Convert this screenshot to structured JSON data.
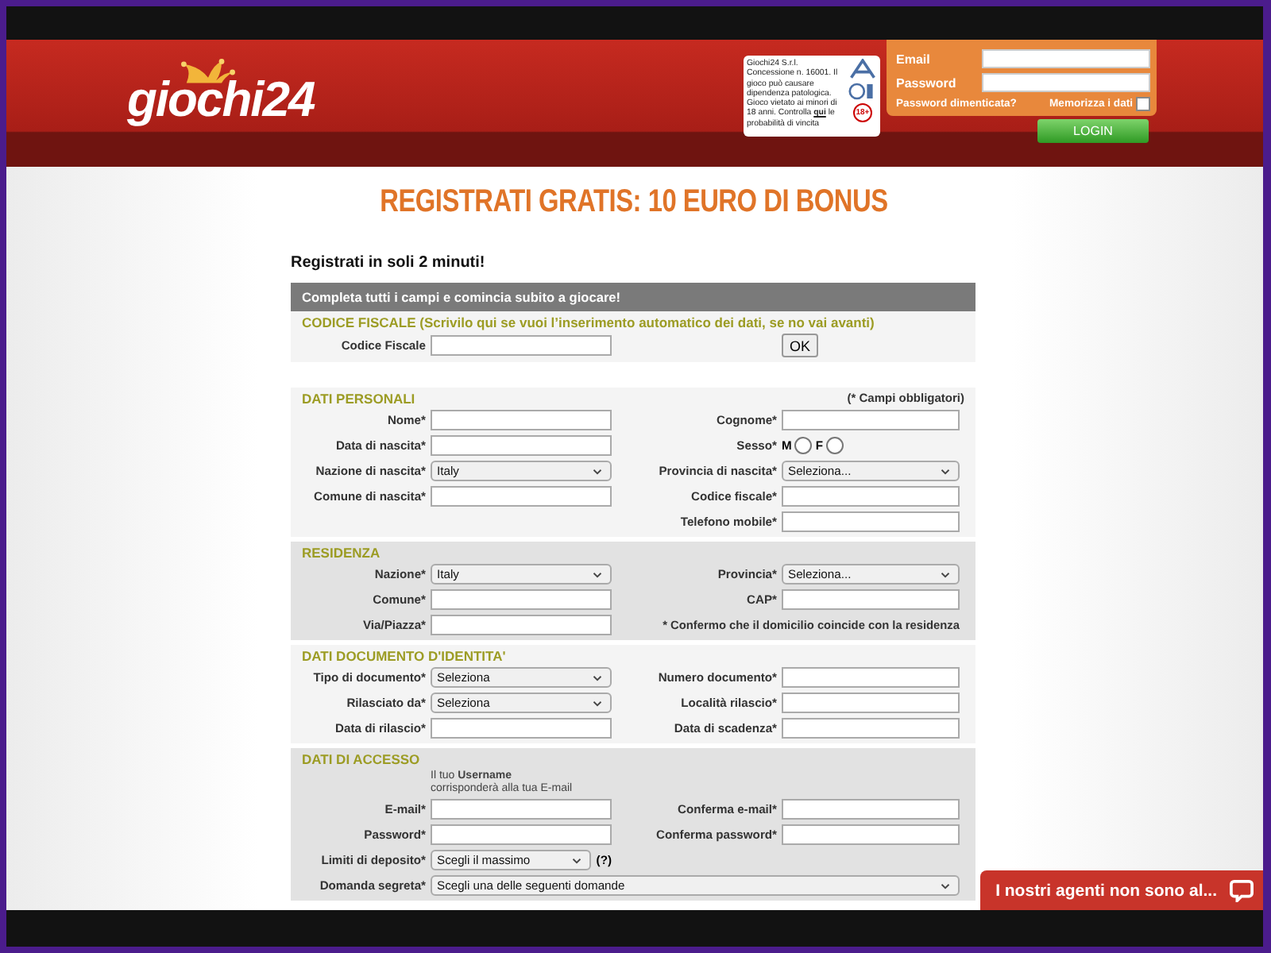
{
  "header": {
    "logo": "giochi24",
    "disclaimer": {
      "before": "Giochi24 S.r.l. Concessione n. 16001. Il gioco può causare dipendenza patologica. Gioco vietato ai minori di 18 anni. Controlla",
      "link": "qui",
      "after": "le probabilità di vincita"
    },
    "age_badge": "18+",
    "login": {
      "email_label": "Email",
      "password_label": "Password",
      "forgot_link": "Password dimenticata?",
      "remember_label": "Memorizza i dati",
      "remember_checked": false,
      "button": "LOGIN"
    }
  },
  "banner": "REGISTRATI GRATIS: 10 EURO DI BONUS",
  "intro": "Registrati in soli 2 minuti!",
  "form_bar": "Completa tutti i campi e comincia subito a giocare!",
  "sections": [
    {
      "title": "CODICE FISCALE (Scrivilo qui se vuoi l’inserimento automatico dei dati, se no vai avanti)",
      "shaded": false,
      "rows": [
        {
          "left": {
            "kind": "input",
            "label": "Codice Fiscale"
          },
          "right": {
            "kind": "button",
            "label": "OK"
          }
        }
      ]
    },
    {
      "title": "DATI PERSONALI",
      "note": "(* Campi obbligatori)",
      "shaded": false,
      "rows": [
        {
          "left": {
            "kind": "input",
            "label": "Nome*"
          },
          "right": {
            "kind": "input",
            "label": "Cognome*"
          }
        },
        {
          "left": {
            "kind": "input",
            "label": "Data di nascita*"
          },
          "right": {
            "kind": "radio",
            "label": "Sesso*",
            "options": [
              {
                "label": "M",
                "selected": false
              },
              {
                "label": "F",
                "selected": false
              }
            ]
          }
        },
        {
          "left": {
            "kind": "select",
            "label": "Nazione di nascita*",
            "value": "Italy"
          },
          "right": {
            "kind": "select",
            "label": "Provincia di nascita*",
            "value": "Seleziona..."
          }
        },
        {
          "left": {
            "kind": "input",
            "label": "Comune di nascita*"
          },
          "right": {
            "kind": "input",
            "label": "Codice fiscale*"
          }
        },
        {
          "right": {
            "kind": "input",
            "label": "Telefono mobile*"
          }
        }
      ]
    },
    {
      "title": "RESIDENZA",
      "shaded": true,
      "rows": [
        {
          "left": {
            "kind": "select",
            "label": "Nazione*",
            "value": "Italy"
          },
          "right": {
            "kind": "select",
            "label": "Provincia*",
            "value": "Seleziona..."
          }
        },
        {
          "left": {
            "kind": "input",
            "label": "Comune*"
          },
          "right": {
            "kind": "input",
            "label": "CAP*"
          }
        },
        {
          "left": {
            "kind": "input",
            "label": "Via/Piazza*"
          },
          "right": {
            "kind": "note",
            "text": "* Confermo che il domicilio coincide con la residenza"
          }
        }
      ]
    },
    {
      "title": "DATI DOCUMENTO D'IDENTITA'",
      "shaded": false,
      "rows": [
        {
          "left": {
            "kind": "select",
            "label": "Tipo di documento*",
            "value": "Seleziona"
          },
          "right": {
            "kind": "input",
            "label": "Numero documento*"
          }
        },
        {
          "left": {
            "kind": "select",
            "label": "Rilasciato da*",
            "value": "Seleziona"
          },
          "right": {
            "kind": "input",
            "label": "Località rilascio*"
          }
        },
        {
          "left": {
            "kind": "input",
            "label": "Data di rilascio*"
          },
          "right": {
            "kind": "input",
            "label": "Data di scadenza*"
          }
        }
      ]
    },
    {
      "title": "DATI DI ACCESSO",
      "shaded": true,
      "rows": [
        {
          "left": {
            "kind": "hint",
            "text": "Il tuo **Username**\ncorrisponderà alla tua E-mail"
          }
        },
        {
          "left": {
            "kind": "input",
            "label": "E-mail*"
          },
          "right": {
            "kind": "input",
            "label": "Conferma e-mail*"
          }
        },
        {
          "left": {
            "kind": "input",
            "label": "Password*"
          },
          "right": {
            "kind": "input",
            "label": "Conferma password*"
          }
        },
        {
          "left": {
            "kind": "select",
            "label": "Limiti di deposito*",
            "value": "Scegli il massimo",
            "suffix": "(?)"
          }
        },
        {
          "left": {
            "kind": "wide_select",
            "label": "Domanda segreta*",
            "value": "Scegli una delle seguenti domande"
          }
        }
      ]
    }
  ],
  "chat": {
    "label": "I nostri agenti non sono al..."
  }
}
